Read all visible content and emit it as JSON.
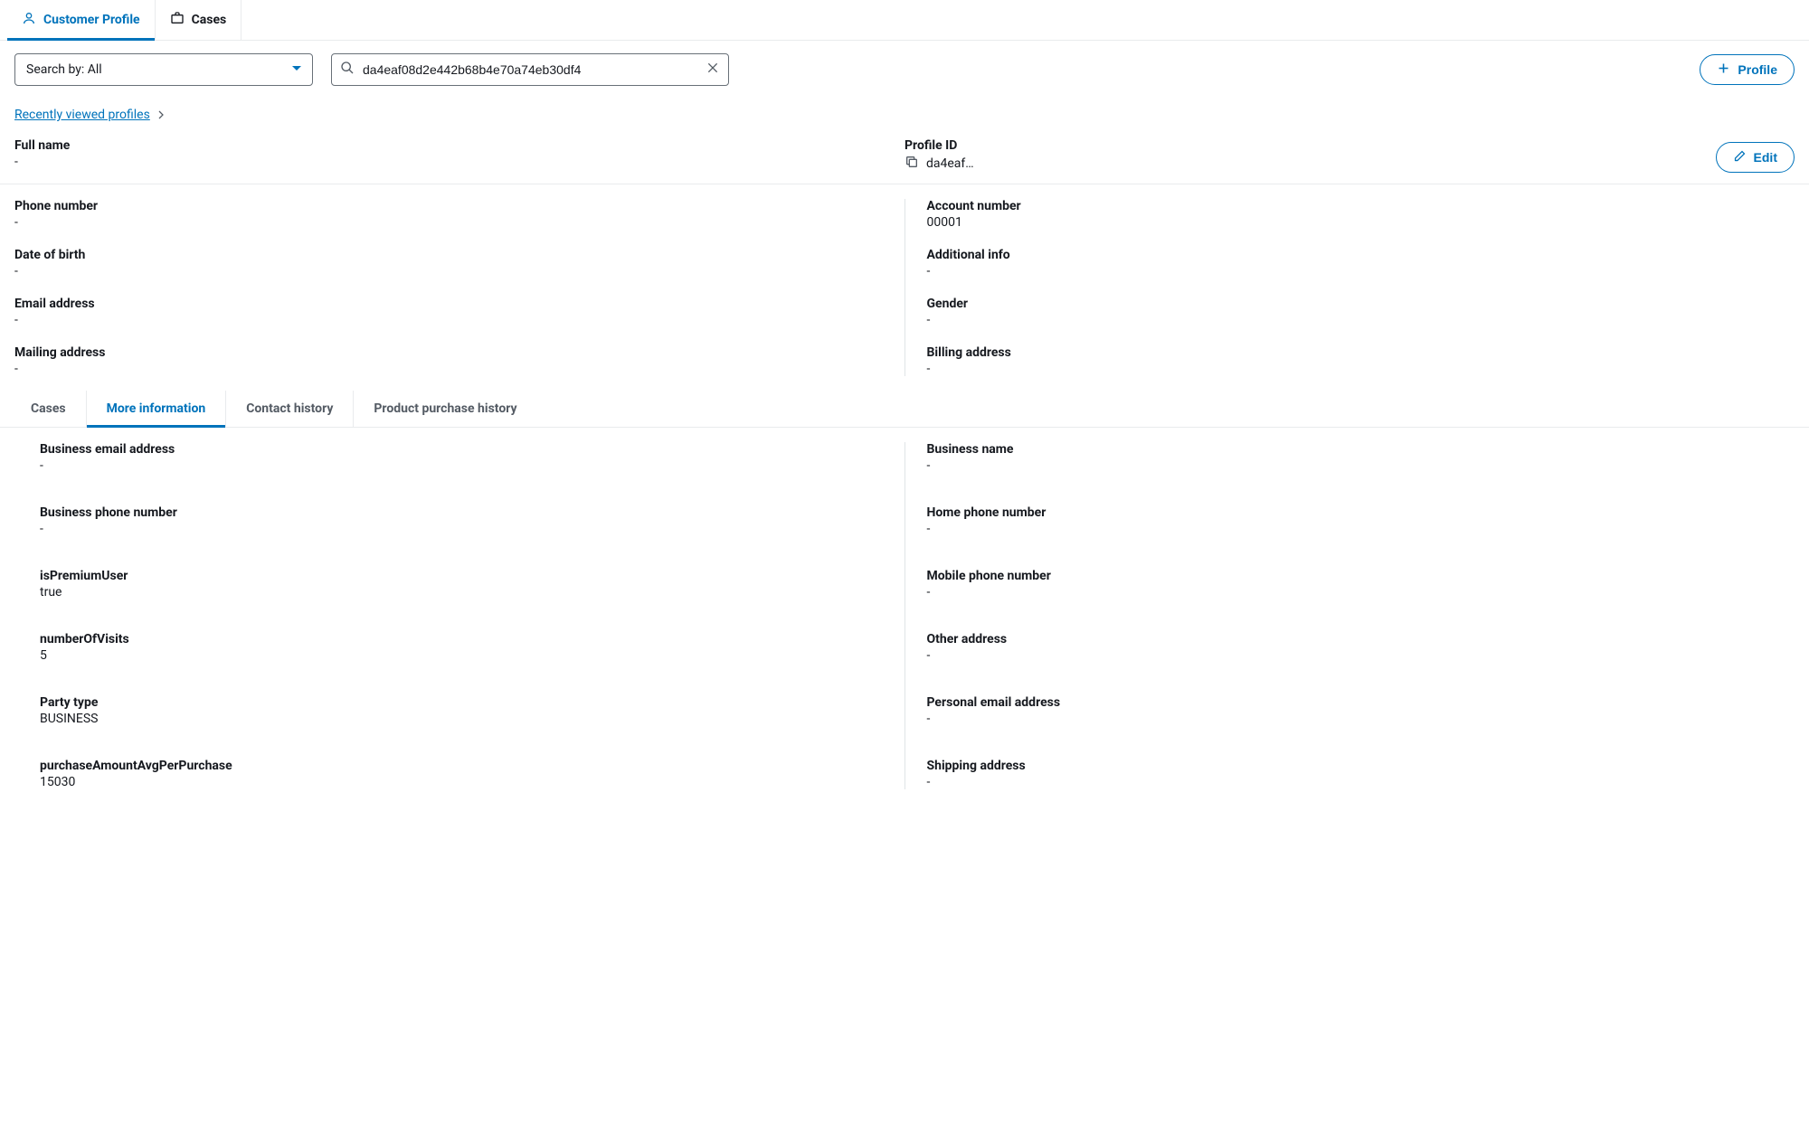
{
  "topTabs": {
    "customerProfile": "Customer Profile",
    "cases": "Cases"
  },
  "toolbar": {
    "searchByLabel": "Search by: All",
    "searchValue": "da4eaf08d2e442b68b4e70a74eb30df4",
    "profileButton": "Profile"
  },
  "recentLink": "Recently viewed profiles",
  "editButton": "Edit",
  "summary": {
    "fullName": {
      "label": "Full name",
      "value": "-"
    },
    "profileId": {
      "label": "Profile ID",
      "value": "da4eaf…"
    }
  },
  "details": {
    "left": [
      {
        "label": "Phone number",
        "value": "-"
      },
      {
        "label": "Date of birth",
        "value": "-"
      },
      {
        "label": "Email address",
        "value": "-"
      },
      {
        "label": "Mailing address",
        "value": "-"
      }
    ],
    "right": [
      {
        "label": "Account number",
        "value": "00001"
      },
      {
        "label": "Additional info",
        "value": "-"
      },
      {
        "label": "Gender",
        "value": "-"
      },
      {
        "label": "Billing address",
        "value": "-"
      }
    ]
  },
  "subTabs": {
    "cases": "Cases",
    "moreInfo": "More information",
    "contactHistory": "Contact history",
    "purchaseHistory": "Product purchase history"
  },
  "moreInfo": {
    "left": [
      {
        "label": "Business email address",
        "value": "-"
      },
      {
        "label": "Business phone number",
        "value": "-"
      },
      {
        "label": "isPremiumUser",
        "value": "true"
      },
      {
        "label": "numberOfVisits",
        "value": "5"
      },
      {
        "label": "Party type",
        "value": "BUSINESS"
      },
      {
        "label": "purchaseAmountAvgPerPurchase",
        "value": "15030"
      }
    ],
    "right": [
      {
        "label": "Business name",
        "value": "-"
      },
      {
        "label": "Home phone number",
        "value": "-"
      },
      {
        "label": "Mobile phone number",
        "value": "-"
      },
      {
        "label": "Other address",
        "value": "-"
      },
      {
        "label": "Personal email address",
        "value": "-"
      },
      {
        "label": "Shipping address",
        "value": "-"
      }
    ]
  }
}
